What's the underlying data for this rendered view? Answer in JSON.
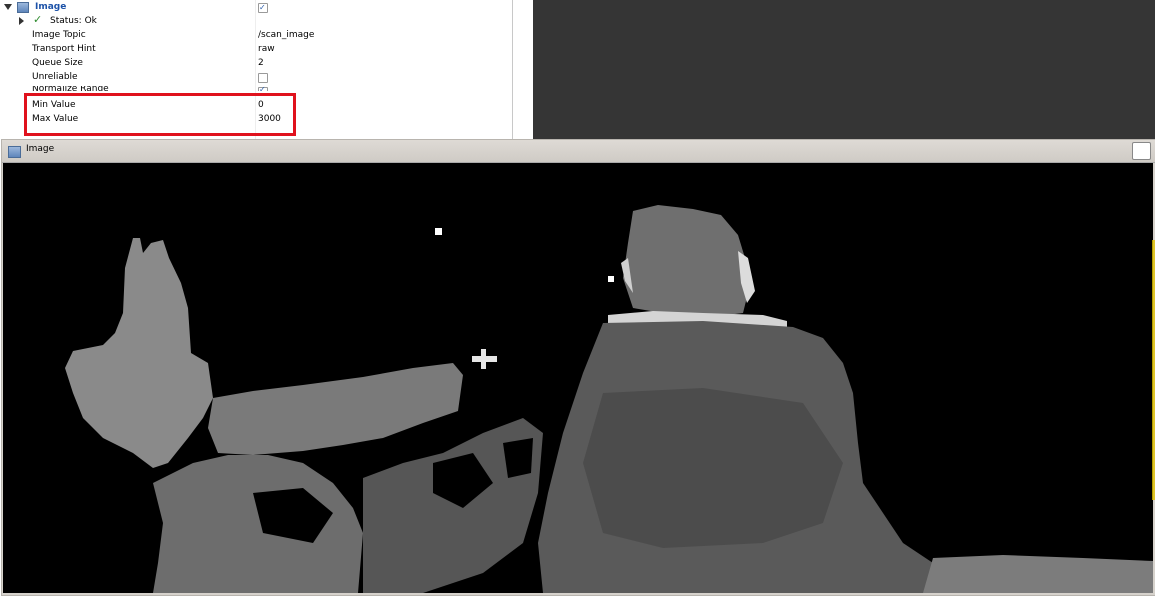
{
  "properties": {
    "display_name": "Image",
    "enabled": true,
    "status": "Status: Ok",
    "rows": [
      {
        "key": "Image Topic",
        "value": "/scan_image"
      },
      {
        "key": "Transport Hint",
        "value": "raw"
      },
      {
        "key": "Queue Size",
        "value": "2"
      },
      {
        "key": "Unreliable",
        "checked": false
      },
      {
        "key": "Normalize Range",
        "checked": true
      },
      {
        "key": "Min Value",
        "value": "0"
      },
      {
        "key": "Max Value",
        "value": "3000"
      }
    ]
  },
  "image_panel": {
    "title": "Image"
  },
  "colors": {
    "highlight_box": "#e0121d",
    "viewer_background": "#353535",
    "image_background": "#000000"
  }
}
